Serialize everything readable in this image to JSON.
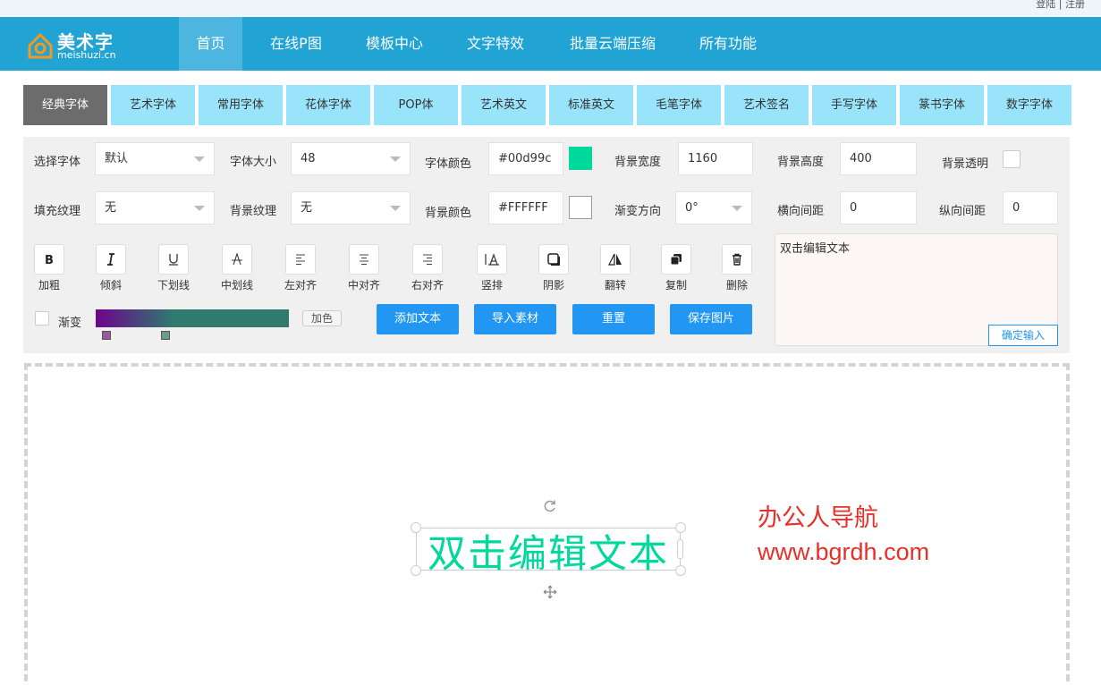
{
  "account": {
    "login": "登陆",
    "separator": " | ",
    "register": "注册"
  },
  "logo": {
    "title": "美术字",
    "subtitle": "meishuzi.cn"
  },
  "nav": [
    "首页",
    "在线P图",
    "模板中心",
    "文字特效",
    "批量云端压缩",
    "所有功能"
  ],
  "tabs": [
    "经典字体",
    "艺术字体",
    "常用字体",
    "花体字体",
    "POP体",
    "艺术英文",
    "标准英文",
    "毛笔字体",
    "艺术签名",
    "手写字体",
    "篆书字体",
    "数字字体"
  ],
  "controls": {
    "font_label": "选择字体",
    "font_value": "默认",
    "size_label": "字体大小",
    "size_value": "48",
    "color_label": "字体颜色",
    "color_value": "#00d99c",
    "color_swatch": "#00d99c",
    "bg_width_label": "背景宽度",
    "bg_width_value": "1160",
    "bg_height_label": "背景高度",
    "bg_height_value": "400",
    "bg_transparent_label": "背景透明",
    "fill_label": "填充纹理",
    "fill_value": "无",
    "bg_texture_label": "背景纹理",
    "bg_texture_value": "无",
    "bg_color_label": "背景颜色",
    "bg_color_value": "#FFFFFF",
    "bg_color_swatch": "#FFFFFF",
    "gradient_dir_label": "渐变方向",
    "gradient_dir_value": "0°",
    "h_spacing_label": "横向间距",
    "h_spacing_value": "0",
    "v_spacing_label": "纵向间距",
    "v_spacing_value": "0"
  },
  "tools": [
    {
      "label": "加粗",
      "icon": "bold-icon"
    },
    {
      "label": "倾斜",
      "icon": "italic-icon"
    },
    {
      "label": "下划线",
      "icon": "underline-icon"
    },
    {
      "label": "中划线",
      "icon": "strikethrough-icon"
    },
    {
      "label": "左对齐",
      "icon": "align-left-icon"
    },
    {
      "label": "中对齐",
      "icon": "align-center-icon"
    },
    {
      "label": "右对齐",
      "icon": "align-right-icon"
    },
    {
      "label": "竖排",
      "icon": "vertical-text-icon"
    },
    {
      "label": "阴影",
      "icon": "shadow-icon"
    },
    {
      "label": "翻转",
      "icon": "flip-icon"
    },
    {
      "label": "复制",
      "icon": "copy-icon"
    },
    {
      "label": "删除",
      "icon": "trash-icon"
    }
  ],
  "gradient": {
    "label": "渐变",
    "add_color": "加色",
    "stop_colors": [
      "#9b5a9b",
      "#6a9a90"
    ]
  },
  "buttons": {
    "add_text": "添加文本",
    "import": "导入素材",
    "reset": "重置",
    "save": "保存图片"
  },
  "text_input": {
    "value": "双击编辑文本",
    "confirm": "确定输入"
  },
  "canvas": {
    "text": "双击编辑文本",
    "watermark_line1": "办公人导航",
    "watermark_line2": "www.bgrdh.com"
  }
}
